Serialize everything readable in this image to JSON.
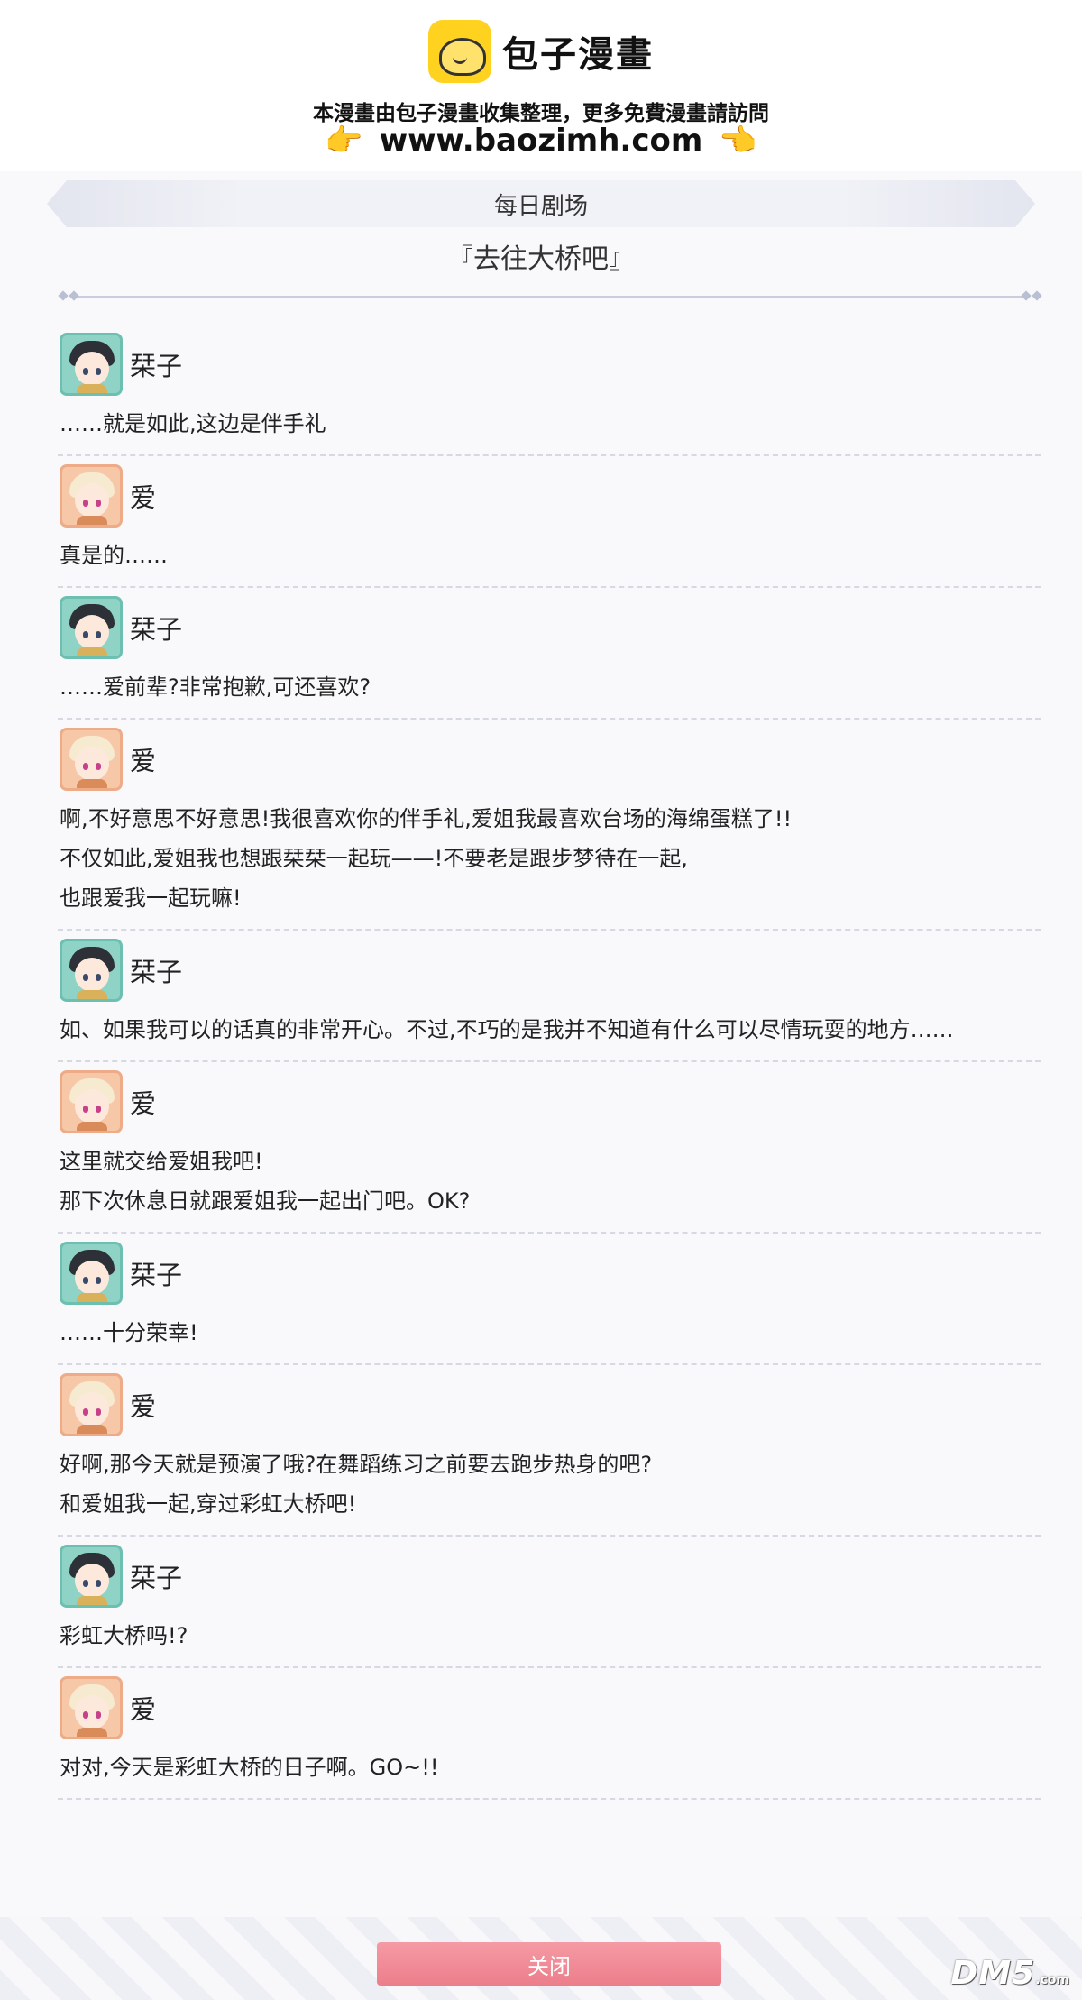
{
  "watermark": {
    "brand": "包子漫畫",
    "notice": "本漫畫由包子漫畫收集整理，更多免費漫畫請訪問",
    "url": "www.baozimh.com",
    "hand_left": "👉",
    "hand_right": "👈"
  },
  "header": {
    "title": "每日剧场",
    "story_title": "『去往大桥吧』"
  },
  "dialogue": [
    {
      "speaker": "栞子",
      "avatar": "teal",
      "lines": [
        "……就是如此,这边是伴手礼"
      ]
    },
    {
      "speaker": "爱",
      "avatar": "peach",
      "lines": [
        "真是的……"
      ]
    },
    {
      "speaker": "栞子",
      "avatar": "teal",
      "lines": [
        "……爱前辈?非常抱歉,可还喜欢?"
      ]
    },
    {
      "speaker": "爱",
      "avatar": "peach",
      "lines": [
        "啊,不好意思不好意思!我很喜欢你的伴手礼,爱姐我最喜欢台场的海绵蛋糕了!!",
        "不仅如此,爱姐我也想跟栞栞一起玩——!不要老是跟步梦待在一起,",
        "也跟爱我一起玩嘛!"
      ]
    },
    {
      "speaker": "栞子",
      "avatar": "teal",
      "lines": [
        "如、如果我可以的话真的非常开心。不过,不巧的是我并不知道有什么可以尽情玩耍的地方……"
      ]
    },
    {
      "speaker": "爱",
      "avatar": "peach",
      "lines": [
        "这里就交给爱姐我吧!",
        "那下次休息日就跟爱姐我一起出门吧。OK?"
      ]
    },
    {
      "speaker": "栞子",
      "avatar": "teal",
      "lines": [
        "……十分荣幸!"
      ]
    },
    {
      "speaker": "爱",
      "avatar": "peach",
      "lines": [
        "好啊,那今天就是预演了哦?在舞蹈练习之前要去跑步热身的吧?",
        "和爱姐我一起,穿过彩虹大桥吧!"
      ]
    },
    {
      "speaker": "栞子",
      "avatar": "teal",
      "lines": [
        "彩虹大桥吗!?"
      ]
    },
    {
      "speaker": "爱",
      "avatar": "peach",
      "lines": [
        "对对,今天是彩虹大桥的日子啊。GO~!!"
      ]
    }
  ],
  "footer": {
    "close_label": "关闭",
    "site_logo": "DM5",
    "site_logo_suffix": ".com"
  },
  "colors": {
    "close_button": "#ec7e8b",
    "avatar_shioriko": "#8fd3c6",
    "avatar_ai": "#f7c8a8",
    "watermark_logo": "#ffd21f"
  }
}
